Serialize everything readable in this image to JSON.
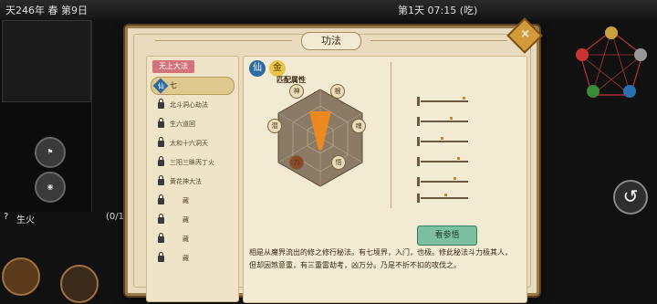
{
  "hud": {
    "date": "天246年 春 第9日",
    "day_time": "第1天 07:15 (吃)",
    "status_label": "生火",
    "status_count": "(0/1"
  },
  "wuxing": [
    "土",
    "金",
    "水",
    "木",
    "火"
  ],
  "dialog": {
    "title": "功法",
    "close": "✕",
    "list_header": "无上大法",
    "skills": [
      {
        "name": "七",
        "locked": false,
        "selected": true
      },
      {
        "name": "北斗洞心劫法",
        "locked": true
      },
      {
        "name": "生六道回",
        "locked": true
      },
      {
        "name": "太和十六洞天",
        "locked": true
      },
      {
        "name": "三阳三眛丙丁火",
        "locked": true
      },
      {
        "name": "黄花神大法",
        "locked": true
      },
      {
        "name": "藏",
        "locked": true
      },
      {
        "name": "藏",
        "locked": true
      },
      {
        "name": "藏",
        "locked": true
      },
      {
        "name": "藏",
        "locked": true
      }
    ],
    "selected_badge": "仙",
    "element_badges": [
      "仙",
      "金"
    ],
    "attr_title": "匹配属性",
    "radar_nodes": [
      "神",
      "根",
      "魂",
      "悟",
      "力",
      "潜"
    ],
    "view_button": "看参悟",
    "description": "相是从魔界流出的修之修行秘法。有七境界，入门，也极。修此秘法斗力极其人，但却因煞意重，有三重雷劫考，凶万分。乃是不折不扣的攻伐之。"
  },
  "colors": {
    "accent": "#d19a3a",
    "list_header": "#d2727a",
    "button": "#7cc0a0"
  }
}
